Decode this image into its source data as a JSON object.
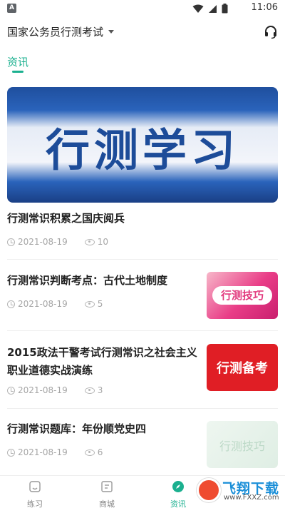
{
  "status_bar": {
    "badge": "A",
    "time": "11:06",
    "icons": [
      "wifi-icon",
      "signal-icon",
      "battery-icon"
    ]
  },
  "header": {
    "exam_selector": "国家公务员行测考试",
    "icon": "headset-icon"
  },
  "tabs": [
    {
      "label": "资讯",
      "active": true
    }
  ],
  "banner": {
    "text": "行测学习",
    "colors": [
      "#1f4f9e",
      "#f3f5fa"
    ]
  },
  "articles": [
    {
      "title": "行测常识积累之国庆阅兵",
      "date": "2021-08-19",
      "views": "10"
    },
    {
      "title": "行测常识判断考点：古代土地制度",
      "date": "2021-08-19",
      "views": "5",
      "thumb": "行测技巧"
    },
    {
      "title_line1": "2015政法干警考试行测常识之社会主义",
      "title_line2": "职业道德实战演练",
      "date": "2021-08-19",
      "views": "3",
      "thumb": "行测备考"
    },
    {
      "title": "行测常识题库：年份顺党史四",
      "date": "2021-08-19",
      "views": "6",
      "thumb": "行测技巧"
    }
  ],
  "bottom_nav": [
    {
      "label": "练习",
      "icon": "practice-icon",
      "active": false
    },
    {
      "label": "商城",
      "icon": "shop-icon",
      "active": false
    },
    {
      "label": "资讯",
      "icon": "compass-icon",
      "active": true
    }
  ],
  "watermark": {
    "text": "飞翔下载",
    "url": "www.FXXZ.com"
  },
  "colors": {
    "accent": "#1bb08f",
    "meta_text": "#a6a6a6"
  }
}
